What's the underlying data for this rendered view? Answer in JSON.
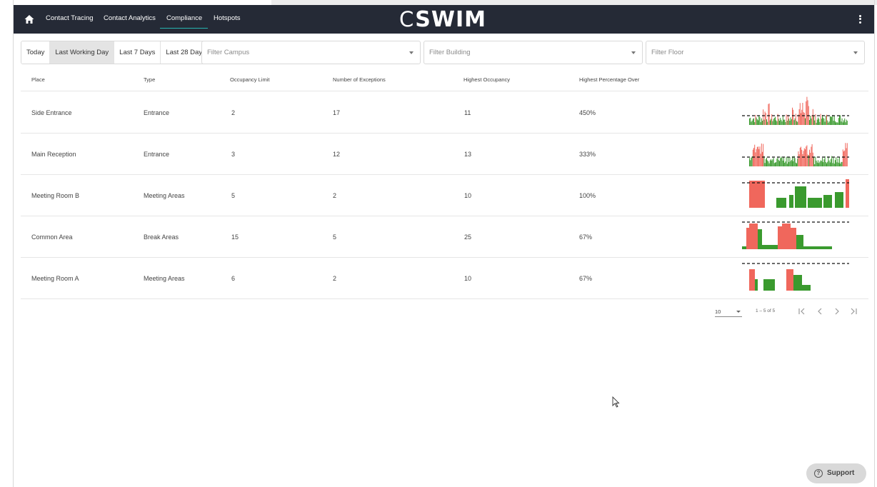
{
  "nav": {
    "home_icon": "home-icon",
    "items": [
      "Contact Tracing",
      "Contact Analytics",
      "Compliance",
      "Hotspots"
    ],
    "active": "Compliance",
    "logo_c": "C",
    "logo_rest": "SWIM",
    "menu_icon": "kebab-menu-icon"
  },
  "filters": {
    "date_ranges": [
      "Today",
      "Last Working Day",
      "Last 7 Days",
      "Last 28 Days"
    ],
    "selected_range": "Last Working Day",
    "campus_placeholder": "Filter Campus",
    "building_placeholder": "Filter Building",
    "floor_placeholder": "Filter Floor"
  },
  "table": {
    "headers": [
      "Place",
      "Type",
      "Occupancy Limit",
      "Number of Exceptions",
      "Highest Occupancy",
      "Highest Percentage Over"
    ],
    "rows": [
      {
        "place": "Side Entrance",
        "type": "Entrance",
        "limit": "2",
        "exceptions": "17",
        "highest": "11",
        "percent": "450%"
      },
      {
        "place": "Main Reception",
        "type": "Entrance",
        "limit": "3",
        "exceptions": "12",
        "highest": "13",
        "percent": "333%"
      },
      {
        "place": "Meeting Room B",
        "type": "Meeting Areas",
        "limit": "5",
        "exceptions": "2",
        "highest": "10",
        "percent": "100%"
      },
      {
        "place": "Common Area",
        "type": "Break Areas",
        "limit": "15",
        "exceptions": "5",
        "highest": "25",
        "percent": "67%"
      },
      {
        "place": "Meeting Room A",
        "type": "Meeting Areas",
        "limit": "6",
        "exceptions": "2",
        "highest": "10",
        "percent": "67%"
      }
    ]
  },
  "pagination": {
    "page_size": "10",
    "range": "1 – 5 of 5",
    "first_icon": "first-page-icon",
    "prev_icon": "prev-page-icon",
    "next_icon": "next-page-icon",
    "last_icon": "last-page-icon"
  },
  "support": {
    "label": "Support",
    "icon": "help-circle-icon",
    "icon_glyph": "?"
  },
  "colors": {
    "navbar": "#252a36",
    "active_underline": "#26b5b0",
    "over_limit": "#f0675c",
    "under_limit": "#3a9a2e"
  }
}
